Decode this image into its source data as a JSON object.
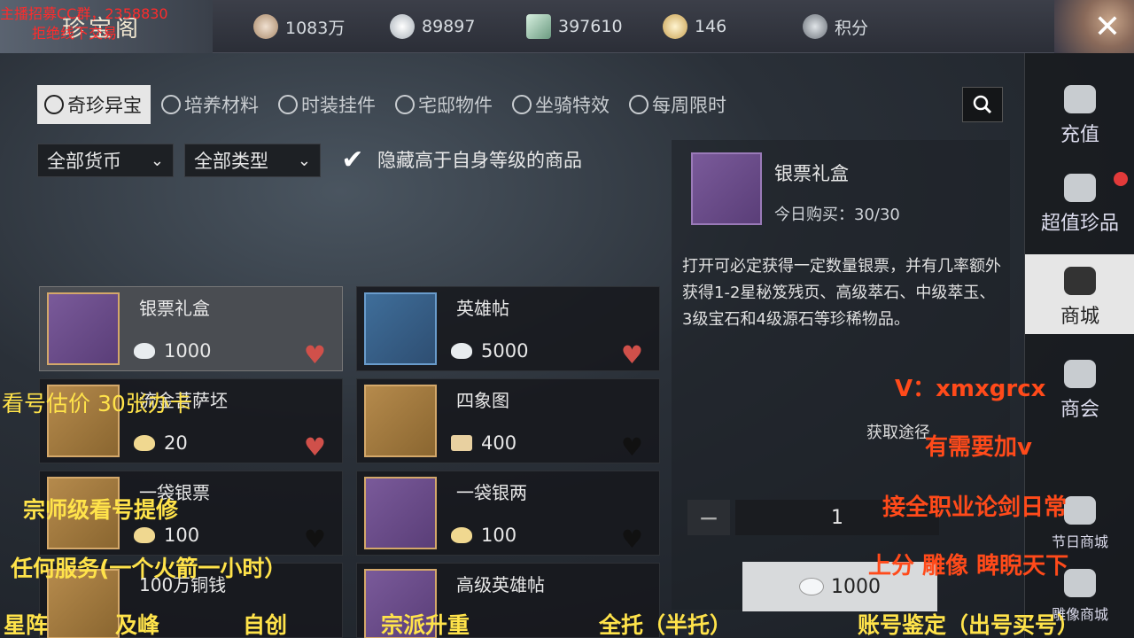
{
  "header": {
    "title": "珍宝阁",
    "currencies": [
      {
        "icon": "coin-bag-icon",
        "value": "1083万"
      },
      {
        "icon": "silver-ingot-icon",
        "value": "89897"
      },
      {
        "icon": "jade-icon",
        "value": "397610"
      },
      {
        "icon": "gold-ingot-icon",
        "value": "146"
      },
      {
        "icon": "points-badge-icon",
        "value": "积分"
      }
    ],
    "close_label": "✕"
  },
  "tabs": [
    {
      "label": "奇珍异宝",
      "active": true
    },
    {
      "label": "培养材料"
    },
    {
      "label": "时装挂件"
    },
    {
      "label": "宅邸物件"
    },
    {
      "label": "坐骑特效"
    },
    {
      "label": "每周限时"
    }
  ],
  "filters": {
    "currency": "全部货币",
    "type": "全部类型",
    "hide_label": "隐藏高于自身等级的商品",
    "hide_checked": true
  },
  "items": [
    {
      "name": "银票礼盒",
      "price": "1000",
      "liked": true
    },
    {
      "name": "英雄帖",
      "price": "5000",
      "liked": true
    },
    {
      "name": "流金菩萨坯",
      "price": "20",
      "liked": true
    },
    {
      "name": "四象图",
      "price": "400",
      "liked": false
    },
    {
      "name": "一袋银票",
      "price": "100",
      "liked": false
    },
    {
      "name": "一袋银两",
      "price": "100",
      "liked": false
    },
    {
      "name": "100万铜钱",
      "price": "",
      "liked": false
    },
    {
      "name": "高级英雄帖",
      "price": "",
      "liked": false
    }
  ],
  "detail": {
    "name": "银票礼盒",
    "limit": "今日购买：30/30",
    "description": "打开可必定获得一定数量银票，并有几率额外获得1-2星秘笈残页、高级萃石、中级萃玉、3级宝石和4级源石等珍稀物品。",
    "source_label": "获取途径",
    "quantity": "1",
    "minus": "−",
    "buy_price": "1000"
  },
  "sidenav": [
    {
      "label": "充值"
    },
    {
      "label": "超值珍品",
      "badge": true
    },
    {
      "label": "商城",
      "active": true
    },
    {
      "label": "商会"
    },
    {
      "label": "节日商城"
    },
    {
      "label": "雕像商城"
    }
  ],
  "overlays": {
    "top_red_1": "主播招募CC群，2358830",
    "top_red_2": "拒绝线下交易",
    "appraise": "看号估价  30张办卡",
    "contact": "V：xmxgrcx",
    "add_v": "有需要加v",
    "master": "宗师级看号提修",
    "daily": "接全职业论剑日常",
    "service": "任何服务(一个火箭一小时）",
    "rank": "上分   雕像   睥睨天下",
    "b1": "星阵",
    "b2": "及峰",
    "b3": "自创",
    "b4": "宗派升重",
    "b5": "全托（半托）",
    "b6": "账号鉴定（出号买号）"
  }
}
